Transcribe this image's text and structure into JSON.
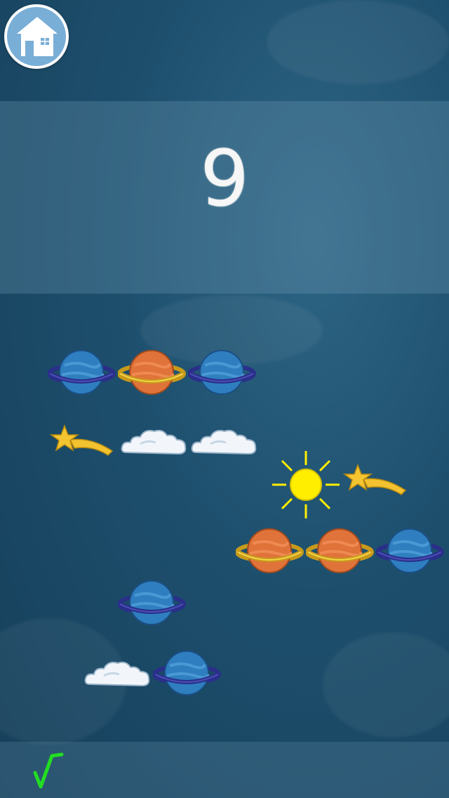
{
  "home_button": {
    "icon": "house-icon",
    "bg_color": "#79aed6"
  },
  "question": {
    "number": "9"
  },
  "rows": [
    [
      "blue-planet",
      "orange-planet",
      "blue-planet"
    ],
    [
      "shooting-star",
      "cloud",
      "cloud"
    ],
    [
      "sun",
      "shooting-star"
    ],
    [
      "orange-planet",
      "orange-planet",
      "blue-planet"
    ],
    [
      "blue-planet"
    ],
    [
      "cloud",
      "blue-planet"
    ]
  ],
  "check_button": {
    "icon": "checkmark-icon",
    "color": "#22dd22"
  },
  "colors": {
    "blue_planet": "#2f7fc0",
    "orange_planet": "#e0733a",
    "ring_gold": "#f2c230",
    "ring_blue": "#2a2f8a",
    "sun": "#ffee00",
    "star": "#f5c531"
  }
}
